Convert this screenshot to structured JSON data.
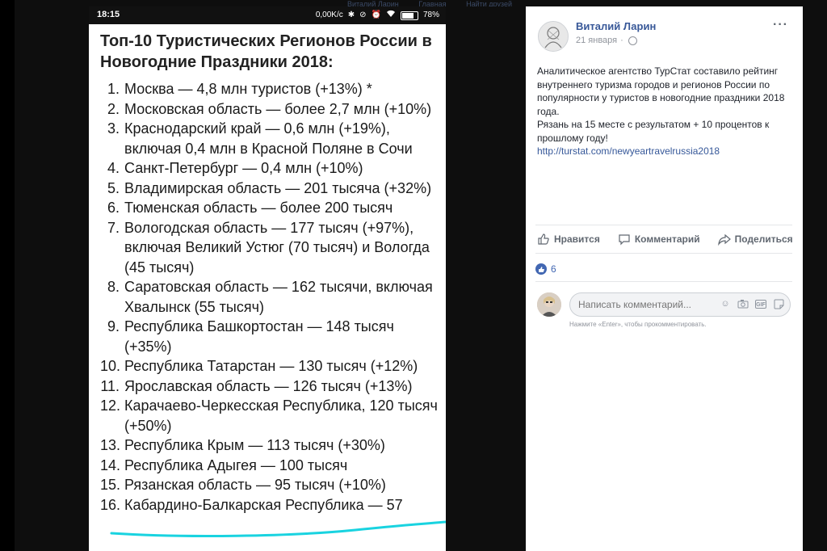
{
  "top_nav_hint": [
    "Виталий Ларин",
    "Главная",
    "Найти друзей"
  ],
  "phone": {
    "status": {
      "time": "18:15",
      "network_speed": "0,00K/c",
      "battery": "78%",
      "battery_level": 0.78
    },
    "article": {
      "title": "Топ-10 Туристических Регионов России в Новогодние Праздники 2018:",
      "items": [
        {
          "num": "1.",
          "text": "Москва — 4,8 млн туристов (+13%) *"
        },
        {
          "num": "2.",
          "text": "Московская область — более 2,7 млн (+10%)"
        },
        {
          "num": "3.",
          "text": "Краснодарский край — 0,6 млн (+19%), включая 0,4 млн в Красной Поляне в Сочи"
        },
        {
          "num": "4.",
          "text": "Санкт-Петербург — 0,4 млн (+10%)"
        },
        {
          "num": "5.",
          "text": "Владимирская область — 201 тысяча (+32%)"
        },
        {
          "num": "6.",
          "text": "Тюменская область — более 200 тысяч"
        },
        {
          "num": "7.",
          "text": "Вологодская область — 177 тысяч (+97%), включая Великий Устюг (70 тысяч) и Вологда (45 тысяч)"
        },
        {
          "num": "8.",
          "text": "Саратовская область — 162 тысячи, включая Хвалынск (55 тысяч)"
        },
        {
          "num": "9.",
          "text": "Республика Башкортостан — 148 тысяч (+35%)"
        },
        {
          "num": "10.",
          "text": "Республика Татарстан — 130 тысяч (+12%)"
        },
        {
          "num": "11.",
          "text": "Ярославская область — 126 тысяч (+13%)"
        },
        {
          "num": "12.",
          "text": "Карачаево-Черкесская Республика, 120 тысяч (+50%)"
        },
        {
          "num": "13.",
          "text": "Республика Крым — 113 тысяч (+30%)"
        },
        {
          "num": "14.",
          "text": "Республика Адыгея — 100 тысяч"
        },
        {
          "num": "15.",
          "text": "Рязанская область — 95 тысяч (+10%)"
        },
        {
          "num": "16.",
          "text": "Кабардино-Балкарская Республика — 57"
        }
      ]
    },
    "highlight_color": "#19d3e0"
  },
  "post": {
    "author": "Виталий Ларин",
    "date": "21 января",
    "more": "···",
    "body_lines": [
      "Аналитическое агентство ТурСтат составило рейтинг внутреннего туризма городов и регионов России по популярности у туристов в новогодние праздники 2018 года.",
      "Рязань на 15 месте с результатом + 10 процентов к прошлому году!"
    ],
    "link": "http://turstat.com/newyeartravelrussia2018",
    "actions": {
      "like": "Нравится",
      "comment": "Комментарий",
      "share": "Поделиться"
    },
    "likes_count": "6",
    "comment_placeholder": "Написать комментарий...",
    "comment_hint": "Нажмите «Enter», чтобы прокомментировать.",
    "gif_label": "GIF",
    "link_color": "#365899",
    "accent": "#4267b2"
  }
}
